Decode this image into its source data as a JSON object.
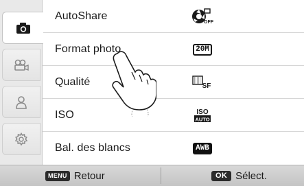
{
  "tabs": [
    {
      "icon": "camera-icon",
      "active": true
    },
    {
      "icon": "video-camera-icon",
      "active": false
    },
    {
      "icon": "person-icon",
      "active": false
    },
    {
      "icon": "gear-icon",
      "active": false
    }
  ],
  "menu": {
    "items": [
      {
        "label": "AutoShare",
        "icon": "autoshare-off-icon"
      },
      {
        "label": "Format photo",
        "icon": "format-20m-icon",
        "icon_text": "20M"
      },
      {
        "label": "Qualité",
        "icon": "quality-superfine-icon",
        "icon_text": "SF"
      },
      {
        "label": "ISO",
        "icon": "iso-auto-icon",
        "icon_text_top": "ISO",
        "icon_text_bottom": "AUTO"
      },
      {
        "label": "Bal. des blancs",
        "icon": "white-balance-auto-icon",
        "icon_text": "AWB"
      }
    ],
    "autoshare_badge": "OFF"
  },
  "bottom_bar": {
    "back_key": "MENU",
    "back_label": "Retour",
    "select_key": "OK",
    "select_label": "Sélect."
  },
  "colors": {
    "tab_bg": "#e9e9e9",
    "bar_bg": "#cccccc",
    "text": "#1a1a1a"
  }
}
